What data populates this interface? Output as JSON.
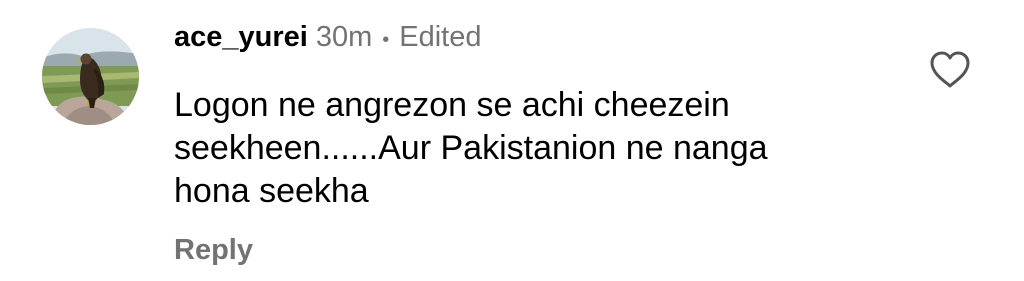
{
  "comment": {
    "username": "ace_yurei",
    "time": "30m",
    "separator": "•",
    "edited": "Edited",
    "text": "Logon ne angrezon se achi cheezein\nseekheen......Aur Pakistanion ne nanga\nhona seekha",
    "reply_label": "Reply",
    "avatar_icon": "eagle-avatar",
    "like_icon": "heart-outline-icon"
  },
  "colors": {
    "primary_text": "#000000",
    "secondary_text": "#737373",
    "background": "#ffffff"
  }
}
